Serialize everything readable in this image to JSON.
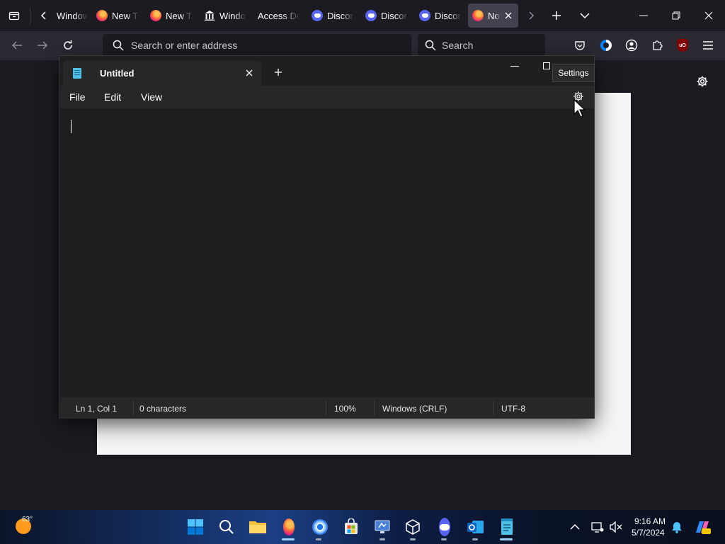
{
  "browser": {
    "tabs": [
      {
        "label": "Windows",
        "favicon": "windows-icon",
        "active": false
      },
      {
        "label": "New Tab",
        "favicon": "firefox-icon",
        "active": false
      },
      {
        "label": "New Tab",
        "favicon": "firefox-icon",
        "active": false
      },
      {
        "label": "Windows",
        "favicon": "museum-icon",
        "active": false
      },
      {
        "label": "Access Denied",
        "favicon": "none",
        "active": false
      },
      {
        "label": "Discord",
        "favicon": "discord-icon",
        "active": false
      },
      {
        "label": "Discord",
        "favicon": "discord-icon",
        "active": false
      },
      {
        "label": "Discord",
        "favicon": "discord-icon",
        "active": false
      },
      {
        "label": "Notepad",
        "favicon": "firefox-icon",
        "active": true
      }
    ],
    "url_placeholder": "Search or enter address",
    "search_placeholder": "Search"
  },
  "tooltip": "Settings",
  "notepad": {
    "tab_title": "Untitled",
    "menu": [
      "File",
      "Edit",
      "View"
    ],
    "status": {
      "position": "Ln 1, Col 1",
      "characters": "0 characters",
      "zoom": "100%",
      "line_ending": "Windows (CRLF)",
      "encoding": "UTF-8"
    }
  },
  "taskbar": {
    "weather_temp": "63°",
    "time": "9:16 AM",
    "date": "5/7/2024"
  },
  "colors": {
    "accent": "#0078d4",
    "browser_bg": "#1c1b22",
    "toolbar_bg": "#2b2a33",
    "notepad_bg": "#202020"
  }
}
